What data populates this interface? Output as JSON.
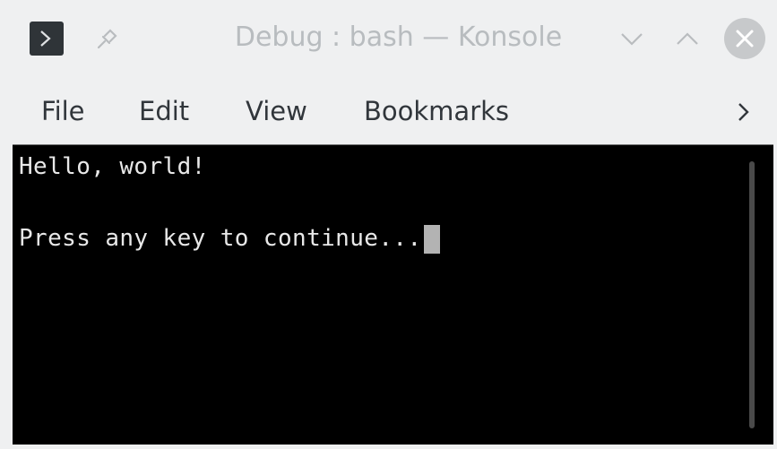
{
  "window": {
    "title": "Debug : bash — Konsole"
  },
  "titlebar": {
    "app_icon": "konsole-terminal-icon",
    "pin_icon": "pin-icon",
    "minimize_icon": "chevron-down-icon",
    "maximize_icon": "chevron-up-icon",
    "close_icon": "close-icon"
  },
  "menubar": {
    "items": [
      {
        "label": "File"
      },
      {
        "label": "Edit"
      },
      {
        "label": "View"
      },
      {
        "label": "Bookmarks"
      }
    ],
    "overflow_icon": "chevron-right-icon"
  },
  "terminal": {
    "lines": [
      "Hello, world!",
      "Press any key to continue..."
    ],
    "background": "#000000",
    "foreground": "#e8e8e8"
  }
}
